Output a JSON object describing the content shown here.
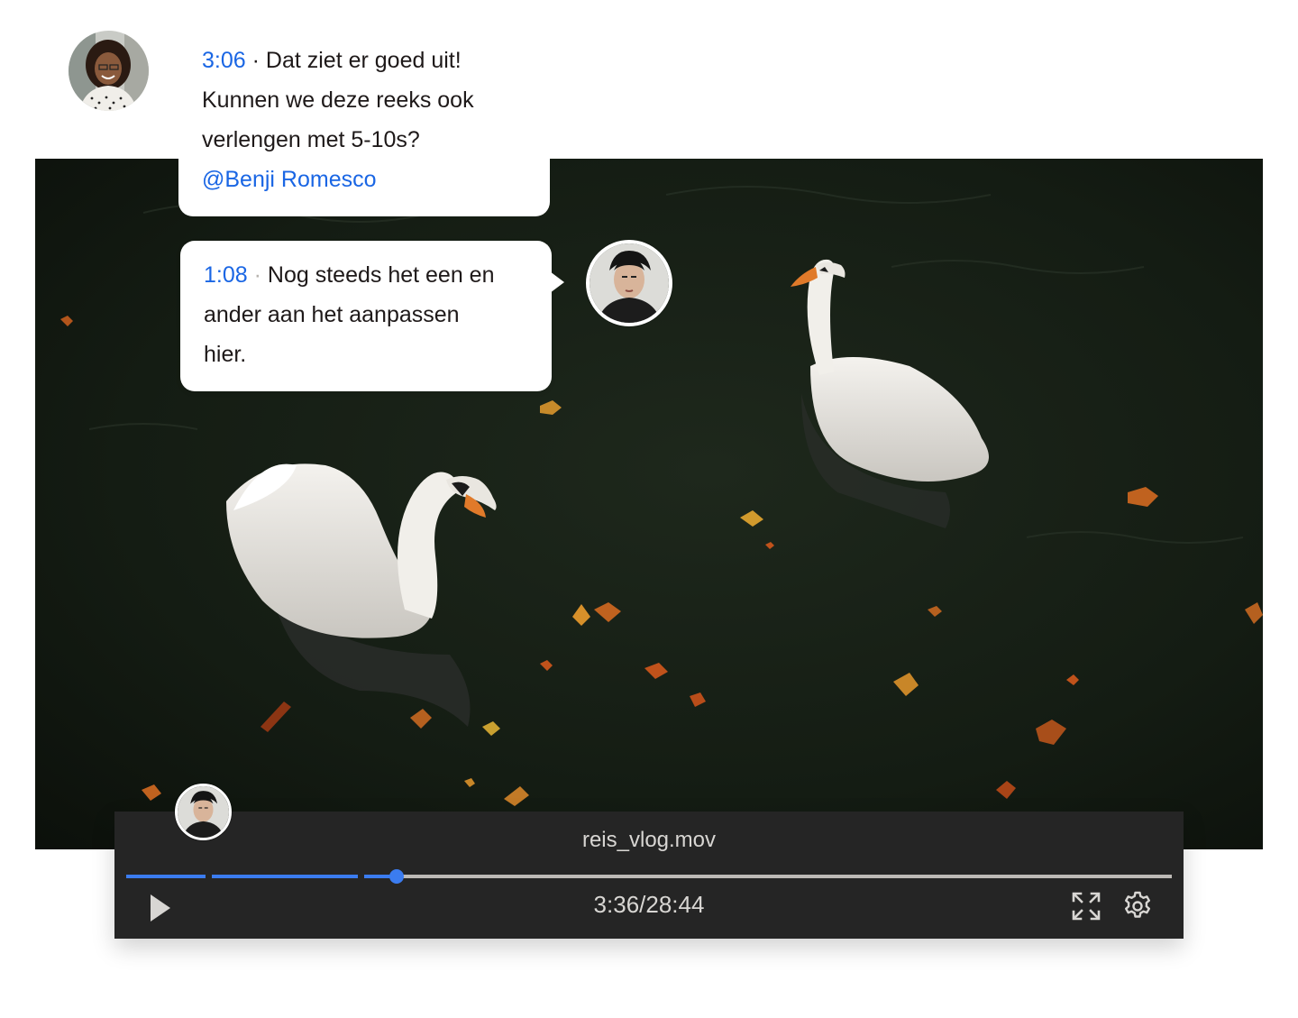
{
  "comments": [
    {
      "timestamp": "3:06",
      "separator": "·",
      "lines": [
        "Dat ziet er goed uit!",
        "Kunnen we deze reeks ook",
        "verlengen met 5-10s?"
      ],
      "mention": "@Benji Romesco"
    },
    {
      "timestamp": "1:08",
      "separator": "·",
      "lines": [
        "Nog steeds het een en",
        "ander aan het aanpassen",
        "hier."
      ]
    }
  ],
  "player": {
    "file_name": "reis_vlog.mov",
    "time_readout": "3:36/28:44",
    "progress_fraction": 0.125
  },
  "icons": {
    "play": "play-icon",
    "fullscreen": "fullscreen-icon",
    "settings": "gear-icon"
  },
  "colors": {
    "accent": "#1a66e4",
    "timeline": "#3b7cf0",
    "player_bg": "#252525"
  }
}
